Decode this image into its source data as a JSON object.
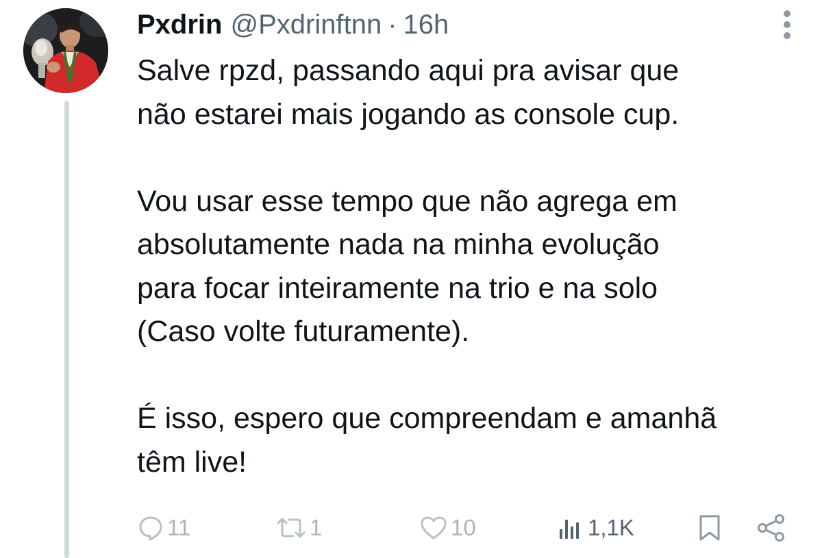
{
  "author": {
    "display_name": "Pxdrin",
    "handle": "@Pxdrinftnn",
    "separator": "·",
    "time": "16h"
  },
  "tweet": {
    "lines": [
      "Salve rpzd, passando aqui pra avisar que",
      "não estarei mais jogando as console cup.",
      "",
      "Vou usar esse tempo que não agrega em",
      "absolutamente nada na minha evolução",
      "para focar inteiramente na trio e na solo",
      "(Caso volte futuramente).",
      "",
      "É isso, espero que compreendam e amanhã",
      "têm live!"
    ]
  },
  "actions": {
    "replies": "11",
    "retweets": "1",
    "likes": "10",
    "views": "1,1K"
  },
  "icons": {
    "more": "more-vertical-icon",
    "reply": "reply-icon",
    "retweet": "retweet-icon",
    "like": "heart-icon",
    "views": "views-icon",
    "bookmark": "bookmark-icon",
    "share": "share-icon"
  },
  "colors": {
    "text": "#0f1419",
    "secondary": "#536471",
    "thread_line": "#cfd9de"
  }
}
